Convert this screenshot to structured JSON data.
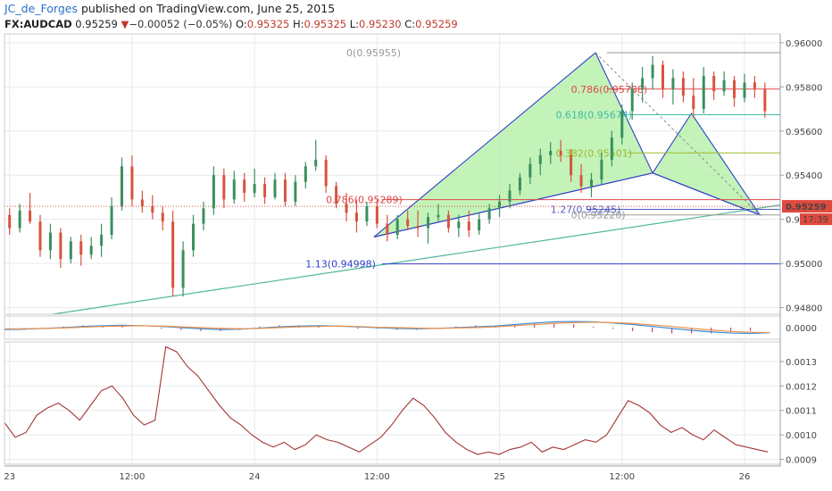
{
  "header": {
    "author": "JC_de_Forges",
    "published": "published on TradingView.com, June 25, 2015",
    "symbol": "FX:AUDCAD",
    "last": "0.95259",
    "down_arrow": "▼",
    "change": "−0.00052 (−0.05%)",
    "o_label": "O:",
    "o_value": "0.95325",
    "h_label": "H:",
    "h_value": "0.95325",
    "l_label": "L:",
    "l_value": "0.95230",
    "c_label": "C:",
    "c_value": "0.95259"
  },
  "colors": {
    "up": "#3a8f5e",
    "down": "#d9533e",
    "grid": "#e6e9ee",
    "pattern_fill": "#b4f0a8",
    "pattern_line": "#3240c8",
    "trendline": "#4fb89a",
    "macd_line": "#3b8ed8",
    "signal_line": "#f0924a",
    "histogram": "#d04080",
    "lower_line": "#a23434"
  },
  "chart_data": [
    {
      "type": "candlestick",
      "title": "",
      "price_axis": {
        "ylim": [
          0.9477,
          0.9604
        ],
        "ticks": [
          "0.96000",
          "0.95800",
          "0.95600",
          "0.95400",
          "0.95200",
          "0.95000",
          "0.94800"
        ],
        "tick_values": [
          0.96,
          0.958,
          0.956,
          0.954,
          0.952,
          0.95,
          0.948
        ]
      },
      "last_price": {
        "label": "0.95259",
        "value": 0.95259
      },
      "countdown": "17:39",
      "time_axis": {
        "labels": [
          "23",
          "12:00",
          "24",
          "12:00",
          "25",
          "12:00",
          "26"
        ],
        "positions": [
          0,
          12,
          24,
          36,
          48,
          60,
          72
        ],
        "range": [
          -0.5,
          75.5
        ]
      },
      "candles": [
        {
          "t": 0,
          "o": 0.9522,
          "h": 0.9525,
          "l": 0.9513,
          "c": 0.9516
        },
        {
          "t": 1,
          "o": 0.9516,
          "h": 0.9527,
          "l": 0.9514,
          "c": 0.9524
        },
        {
          "t": 2,
          "o": 0.9524,
          "h": 0.9532,
          "l": 0.9518,
          "c": 0.9519
        },
        {
          "t": 3,
          "o": 0.9519,
          "h": 0.9522,
          "l": 0.9503,
          "c": 0.9506
        },
        {
          "t": 4,
          "o": 0.9506,
          "h": 0.9518,
          "l": 0.9502,
          "c": 0.9514
        },
        {
          "t": 5,
          "o": 0.9514,
          "h": 0.9516,
          "l": 0.9498,
          "c": 0.9502
        },
        {
          "t": 6,
          "o": 0.9502,
          "h": 0.9512,
          "l": 0.95,
          "c": 0.951
        },
        {
          "t": 7,
          "o": 0.951,
          "h": 0.9513,
          "l": 0.9499,
          "c": 0.9504
        },
        {
          "t": 8,
          "o": 0.9504,
          "h": 0.9512,
          "l": 0.9502,
          "c": 0.9508
        },
        {
          "t": 9,
          "o": 0.9508,
          "h": 0.9518,
          "l": 0.9503,
          "c": 0.9513
        },
        {
          "t": 10,
          "o": 0.9513,
          "h": 0.953,
          "l": 0.9511,
          "c": 0.9526
        },
        {
          "t": 11,
          "o": 0.9526,
          "h": 0.9548,
          "l": 0.9524,
          "c": 0.9544
        },
        {
          "t": 12,
          "o": 0.9544,
          "h": 0.9549,
          "l": 0.9526,
          "c": 0.9529
        },
        {
          "t": 13,
          "o": 0.9529,
          "h": 0.9533,
          "l": 0.9523,
          "c": 0.9526
        },
        {
          "t": 14,
          "o": 0.9526,
          "h": 0.9531,
          "l": 0.952,
          "c": 0.9523
        },
        {
          "t": 15,
          "o": 0.9523,
          "h": 0.9526,
          "l": 0.9515,
          "c": 0.9519
        },
        {
          "t": 16,
          "o": 0.9519,
          "h": 0.9524,
          "l": 0.9485,
          "c": 0.9489
        },
        {
          "t": 17,
          "o": 0.9489,
          "h": 0.951,
          "l": 0.9485,
          "c": 0.9506
        },
        {
          "t": 18,
          "o": 0.9506,
          "h": 0.9522,
          "l": 0.9503,
          "c": 0.9518
        },
        {
          "t": 19,
          "o": 0.9518,
          "h": 0.9528,
          "l": 0.9515,
          "c": 0.9525
        },
        {
          "t": 20,
          "o": 0.9525,
          "h": 0.9544,
          "l": 0.9522,
          "c": 0.954
        },
        {
          "t": 21,
          "o": 0.954,
          "h": 0.9543,
          "l": 0.9525,
          "c": 0.9529
        },
        {
          "t": 22,
          "o": 0.9529,
          "h": 0.9542,
          "l": 0.9527,
          "c": 0.9538
        },
        {
          "t": 23,
          "o": 0.9538,
          "h": 0.9541,
          "l": 0.9528,
          "c": 0.9532
        },
        {
          "t": 24,
          "o": 0.9532,
          "h": 0.9543,
          "l": 0.953,
          "c": 0.9536
        },
        {
          "t": 25,
          "o": 0.9536,
          "h": 0.9539,
          "l": 0.9527,
          "c": 0.953
        },
        {
          "t": 26,
          "o": 0.953,
          "h": 0.9541,
          "l": 0.9529,
          "c": 0.9538
        },
        {
          "t": 27,
          "o": 0.9538,
          "h": 0.9541,
          "l": 0.9526,
          "c": 0.9528
        },
        {
          "t": 28,
          "o": 0.9528,
          "h": 0.954,
          "l": 0.9526,
          "c": 0.9537
        },
        {
          "t": 29,
          "o": 0.9537,
          "h": 0.9546,
          "l": 0.9534,
          "c": 0.9544
        },
        {
          "t": 30,
          "o": 0.9544,
          "h": 0.9556,
          "l": 0.9542,
          "c": 0.9547
        },
        {
          "t": 31,
          "o": 0.9547,
          "h": 0.9549,
          "l": 0.9532,
          "c": 0.9535
        },
        {
          "t": 32,
          "o": 0.9535,
          "h": 0.9537,
          "l": 0.9525,
          "c": 0.9527
        },
        {
          "t": 33,
          "o": 0.9527,
          "h": 0.9532,
          "l": 0.9519,
          "c": 0.9523
        },
        {
          "t": 34,
          "o": 0.9523,
          "h": 0.9529,
          "l": 0.9514,
          "c": 0.9519
        },
        {
          "t": 35,
          "o": 0.9519,
          "h": 0.9528,
          "l": 0.9517,
          "c": 0.9526
        },
        {
          "t": 36,
          "o": 0.9526,
          "h": 0.9529,
          "l": 0.9516,
          "c": 0.9518
        },
        {
          "t": 37,
          "o": 0.9518,
          "h": 0.9522,
          "l": 0.951,
          "c": 0.9513
        },
        {
          "t": 38,
          "o": 0.9513,
          "h": 0.9522,
          "l": 0.9511,
          "c": 0.952
        },
        {
          "t": 39,
          "o": 0.952,
          "h": 0.9524,
          "l": 0.9515,
          "c": 0.9517
        },
        {
          "t": 40,
          "o": 0.9517,
          "h": 0.9524,
          "l": 0.9512,
          "c": 0.9516
        },
        {
          "t": 41,
          "o": 0.9516,
          "h": 0.9523,
          "l": 0.9509,
          "c": 0.9521
        },
        {
          "t": 42,
          "o": 0.9521,
          "h": 0.9527,
          "l": 0.9519,
          "c": 0.9522
        },
        {
          "t": 43,
          "o": 0.9522,
          "h": 0.9524,
          "l": 0.9514,
          "c": 0.9516
        },
        {
          "t": 44,
          "o": 0.9516,
          "h": 0.9522,
          "l": 0.9512,
          "c": 0.9519
        },
        {
          "t": 45,
          "o": 0.9519,
          "h": 0.9524,
          "l": 0.9512,
          "c": 0.9515
        },
        {
          "t": 46,
          "o": 0.9515,
          "h": 0.9523,
          "l": 0.9513,
          "c": 0.952
        },
        {
          "t": 47,
          "o": 0.952,
          "h": 0.9527,
          "l": 0.9518,
          "c": 0.9525
        },
        {
          "t": 48,
          "o": 0.9525,
          "h": 0.9531,
          "l": 0.9521,
          "c": 0.9528
        },
        {
          "t": 49,
          "o": 0.9528,
          "h": 0.9536,
          "l": 0.9525,
          "c": 0.9533
        },
        {
          "t": 50,
          "o": 0.9533,
          "h": 0.9541,
          "l": 0.9531,
          "c": 0.9539
        },
        {
          "t": 51,
          "o": 0.9539,
          "h": 0.9548,
          "l": 0.9536,
          "c": 0.9545
        },
        {
          "t": 52,
          "o": 0.9545,
          "h": 0.9552,
          "l": 0.954,
          "c": 0.9549
        },
        {
          "t": 53,
          "o": 0.9549,
          "h": 0.9555,
          "l": 0.9545,
          "c": 0.9551
        },
        {
          "t": 54,
          "o": 0.9551,
          "h": 0.9556,
          "l": 0.9546,
          "c": 0.9549
        },
        {
          "t": 55,
          "o": 0.9549,
          "h": 0.9552,
          "l": 0.9537,
          "c": 0.954
        },
        {
          "t": 56,
          "o": 0.954,
          "h": 0.9545,
          "l": 0.9532,
          "c": 0.9535
        },
        {
          "t": 57,
          "o": 0.9535,
          "h": 0.9541,
          "l": 0.953,
          "c": 0.9538
        },
        {
          "t": 58,
          "o": 0.9538,
          "h": 0.955,
          "l": 0.9536,
          "c": 0.9547
        },
        {
          "t": 59,
          "o": 0.9547,
          "h": 0.956,
          "l": 0.9544,
          "c": 0.9557
        },
        {
          "t": 60,
          "o": 0.9557,
          "h": 0.9572,
          "l": 0.9554,
          "c": 0.9569
        },
        {
          "t": 61,
          "o": 0.9569,
          "h": 0.9582,
          "l": 0.9565,
          "c": 0.9579
        },
        {
          "t": 62,
          "o": 0.9579,
          "h": 0.9589,
          "l": 0.9573,
          "c": 0.9584
        },
        {
          "t": 63,
          "o": 0.9584,
          "h": 0.9594,
          "l": 0.9579,
          "c": 0.959
        },
        {
          "t": 64,
          "o": 0.959,
          "h": 0.9592,
          "l": 0.9575,
          "c": 0.9579
        },
        {
          "t": 65,
          "o": 0.9579,
          "h": 0.9588,
          "l": 0.9572,
          "c": 0.9584
        },
        {
          "t": 66,
          "o": 0.9584,
          "h": 0.9587,
          "l": 0.9573,
          "c": 0.9576
        },
        {
          "t": 67,
          "o": 0.9576,
          "h": 0.9584,
          "l": 0.9566,
          "c": 0.957
        },
        {
          "t": 68,
          "o": 0.957,
          "h": 0.9589,
          "l": 0.9568,
          "c": 0.9585
        },
        {
          "t": 69,
          "o": 0.9585,
          "h": 0.9587,
          "l": 0.9574,
          "c": 0.9578
        },
        {
          "t": 70,
          "o": 0.9578,
          "h": 0.9587,
          "l": 0.9576,
          "c": 0.9583
        },
        {
          "t": 71,
          "o": 0.9583,
          "h": 0.9585,
          "l": 0.9571,
          "c": 0.9575
        },
        {
          "t": 72,
          "o": 0.9575,
          "h": 0.9586,
          "l": 0.9573,
          "c": 0.9582
        },
        {
          "t": 73,
          "o": 0.9582,
          "h": 0.9585,
          "l": 0.9575,
          "c": 0.9579
        },
        {
          "t": 74,
          "o": 0.9579,
          "h": 0.9582,
          "l": 0.9566,
          "c": 0.9569
        }
      ],
      "levels": [
        {
          "label": "0(0.95955)",
          "value": 0.95955,
          "color": "#9a9a9a"
        },
        {
          "label": "0.786(0.95788)",
          "value": 0.9579,
          "color": "#e04848"
        },
        {
          "label": "0.618(0.95674)",
          "value": 0.95674,
          "color": "#3fb9a4"
        },
        {
          "label": "0.382(0.95501)",
          "value": 0.95501,
          "color": "#9cb82c"
        },
        {
          "label": "0.786(0.95289)",
          "value": 0.95289,
          "color": "#e04848"
        },
        {
          "label": "1.27(0.95245)",
          "value": 0.95245,
          "color": "#5560c8"
        },
        {
          "label": "0(0.95220)",
          "value": 0.9522,
          "color": "#9a9a9a"
        },
        {
          "label": "1.13(0.94998)",
          "value": 0.94998,
          "color": "#3240c8"
        }
      ],
      "pattern_points": [
        {
          "t": 35.7,
          "v": 0.9512
        },
        {
          "t": 57.4,
          "v": 0.95955
        },
        {
          "t": 63.0,
          "v": 0.9541
        },
        {
          "t": 73.5,
          "v": 0.9522
        }
      ],
      "pattern_inner": {
        "t": 66.8,
        "v": 0.9568
      }
    },
    {
      "type": "line",
      "title": "",
      "ylim": [
        -0.0003,
        0.0003
      ],
      "ticks": [
        "0.0000"
      ],
      "tick_values": [
        0
      ],
      "series": [
        {
          "values": [
            -5e-05,
            -4e-05,
            -2e-05,
            0.0,
            3e-05,
            5e-05,
            6e-05,
            5e-05,
            3e-05,
            0.0,
            -3e-05,
            -5e-05,
            -4e-05,
            -1e-05,
            2e-05,
            4e-05,
            5e-05,
            4e-05,
            2e-05,
            0.0,
            -2e-05,
            -3e-05,
            -2e-05,
            0.0,
            2e-05,
            4e-05,
            8e-05,
            0.00012,
            0.00015,
            0.00016,
            0.00015,
            0.00012,
            8e-05,
            3e-05,
            -2e-05,
            -7e-05,
            -0.00011,
            -0.00014,
            -0.00015,
            -0.00013
          ]
        },
        {
          "values": [
            -3e-05,
            -3e-05,
            -2e-05,
            -1e-05,
            1e-05,
            3e-05,
            4e-05,
            5e-05,
            4e-05,
            2e-05,
            0.0,
            -2e-05,
            -3e-05,
            -2e-05,
            0.0,
            2e-05,
            3e-05,
            4e-05,
            3e-05,
            1e-05,
            0.0,
            -1e-05,
            -2e-05,
            -1e-05,
            0.0,
            2e-05,
            5e-05,
            8e-05,
            0.00011,
            0.00013,
            0.00014,
            0.00013,
            0.00011,
            7e-05,
            3e-05,
            -2e-05,
            -6e-05,
            -0.0001,
            -0.00012,
            -0.00013
          ]
        }
      ]
    },
    {
      "type": "line",
      "title": "",
      "ylim": [
        0.00088,
        0.00138
      ],
      "ticks": [
        "0.0013",
        "0.0012",
        "0.0011",
        "0.0010",
        "0.0009"
      ],
      "tick_values": [
        0.0013,
        0.0012,
        0.0011,
        0.001,
        0.0009
      ],
      "series": [
        {
          "values": [
            0.00105,
            0.00099,
            0.00101,
            0.00108,
            0.00111,
            0.00113,
            0.0011,
            0.00106,
            0.00112,
            0.00118,
            0.0012,
            0.00115,
            0.00108,
            0.00104,
            0.00106,
            0.00136,
            0.00134,
            0.00128,
            0.00124,
            0.00118,
            0.00112,
            0.00107,
            0.00104,
            0.001,
            0.00097,
            0.00095,
            0.00097,
            0.00094,
            0.00096,
            0.001,
            0.00098,
            0.00097,
            0.00095,
            0.00093,
            0.00096,
            0.00099,
            0.00104,
            0.0011,
            0.00115,
            0.00112,
            0.00107,
            0.00101,
            0.00097,
            0.00094,
            0.00092,
            0.00093,
            0.00092,
            0.00094,
            0.00095,
            0.00097,
            0.00093,
            0.00095,
            0.00094,
            0.00096,
            0.00098,
            0.00097,
            0.001,
            0.00107,
            0.00114,
            0.00112,
            0.00109,
            0.00104,
            0.00101,
            0.00103,
            0.001,
            0.00098,
            0.00102,
            0.00099,
            0.00096,
            0.00095,
            0.00094,
            0.00093
          ]
        }
      ]
    }
  ]
}
